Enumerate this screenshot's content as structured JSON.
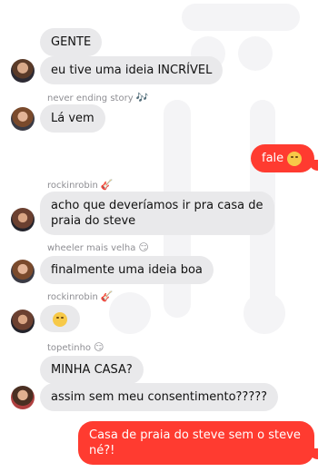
{
  "messages": {
    "m1": "GENTE",
    "m2": "eu tive uma ideia INCRÍVEL",
    "m3_sender": "never ending story",
    "m3_sender_icon": "music-notes-icon",
    "m3": "Lá vem",
    "m4": "fale",
    "m4_icon": "hug-face-emoji",
    "m5_sender": "rockinrobin",
    "m5_sender_icon": "guitar-icon",
    "m5": "acho que deveríamos ir pra casa de praia do steve",
    "m6_sender": "wheeler mais velha",
    "m6_sender_icon": "smirk-face-emoji",
    "m6": "finalmente uma ideia boa",
    "m7_sender": "rockinrobin",
    "m7_sender_icon": "guitar-icon",
    "m7_icon": "eye-roll-face-emoji",
    "m8_sender": "topetinho",
    "m8_sender_icon": "smirk-face-emoji",
    "m8": "MINHA CASA?",
    "m9": "assim sem meu consentimento?????",
    "m10": "Casa de praia do steve sem o steve né?!"
  },
  "colors": {
    "incoming_bubble": "#e9e9eb",
    "outgoing_bubble": "#ff3b30",
    "sender_label": "#8e8e93"
  }
}
